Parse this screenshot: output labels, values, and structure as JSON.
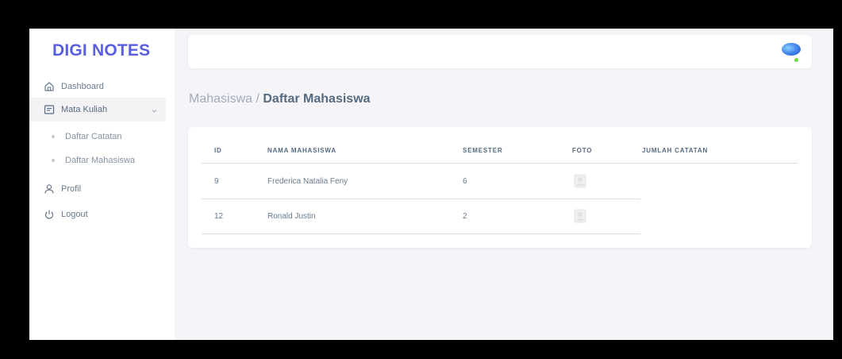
{
  "brand": "DIGI NOTES",
  "sidebar": {
    "items": [
      {
        "label": "Dashboard",
        "icon": "home-icon"
      },
      {
        "label": "Mata Kuliah",
        "icon": "layout-icon"
      },
      {
        "label": "Daftar Catatan"
      },
      {
        "label": "Daftar Mahasiswa"
      },
      {
        "label": "Profil",
        "icon": "user-icon"
      },
      {
        "label": "Logout",
        "icon": "power-icon"
      }
    ]
  },
  "breadcrumb": {
    "parent": "Mahasiswa",
    "separator": " / ",
    "current": "Daftar Mahasiswa"
  },
  "table": {
    "headers": [
      "ID",
      "NAMA MAHASISWA",
      "SEMESTER",
      "FOTO",
      "JUMLAH CATATAN"
    ],
    "rows": [
      {
        "id": "9",
        "nama": "Frederica Natalia Feny",
        "semester": "6",
        "jumlah": ""
      },
      {
        "id": "12",
        "nama": "Ronald Justin",
        "semester": "2",
        "jumlah": ""
      }
    ]
  },
  "colors": {
    "brand": "#5a5fe0",
    "background": "#f5f5f9",
    "online": "#71dd37"
  }
}
